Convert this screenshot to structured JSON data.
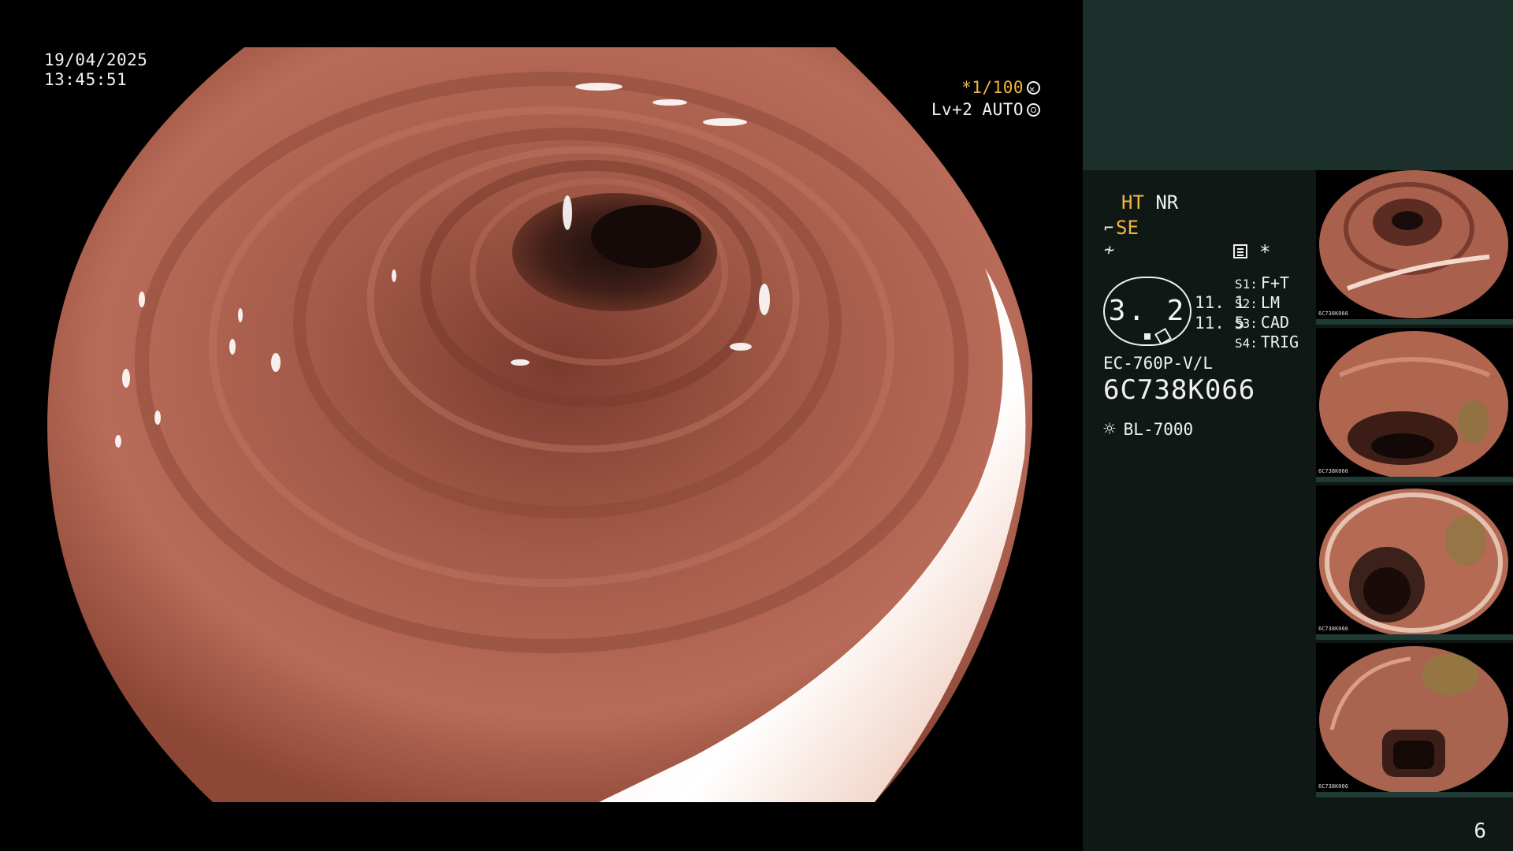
{
  "overlay": {
    "date": "19/04/2025",
    "time": "13:45:51",
    "zoom": "*1/100",
    "level": "Lv+2",
    "mode": "AUTO"
  },
  "info_panel": {
    "ht": "HT",
    "nr": "NR",
    "se": "SE",
    "iris_value": "3. 2",
    "num_a": "11. 1",
    "num_b": "11. 5",
    "switches": [
      {
        "key": "S1:",
        "value": "F+T"
      },
      {
        "key": "S2:",
        "value": "LM"
      },
      {
        "key": "S3:",
        "value": "CAD"
      },
      {
        "key": "S4:",
        "value": "TRIG"
      }
    ],
    "model": "EC-760P-V/L",
    "serial": "6C738K066",
    "light_source": "BL-7000",
    "accent_color": "#f5b63f",
    "top_panel_color": "#1b302b"
  },
  "thumbnails": [
    {
      "label": "6C738K066"
    },
    {
      "label": "6C738K066"
    },
    {
      "label": "6C738K066"
    },
    {
      "label": "6C738K066"
    }
  ],
  "page_number": "6"
}
